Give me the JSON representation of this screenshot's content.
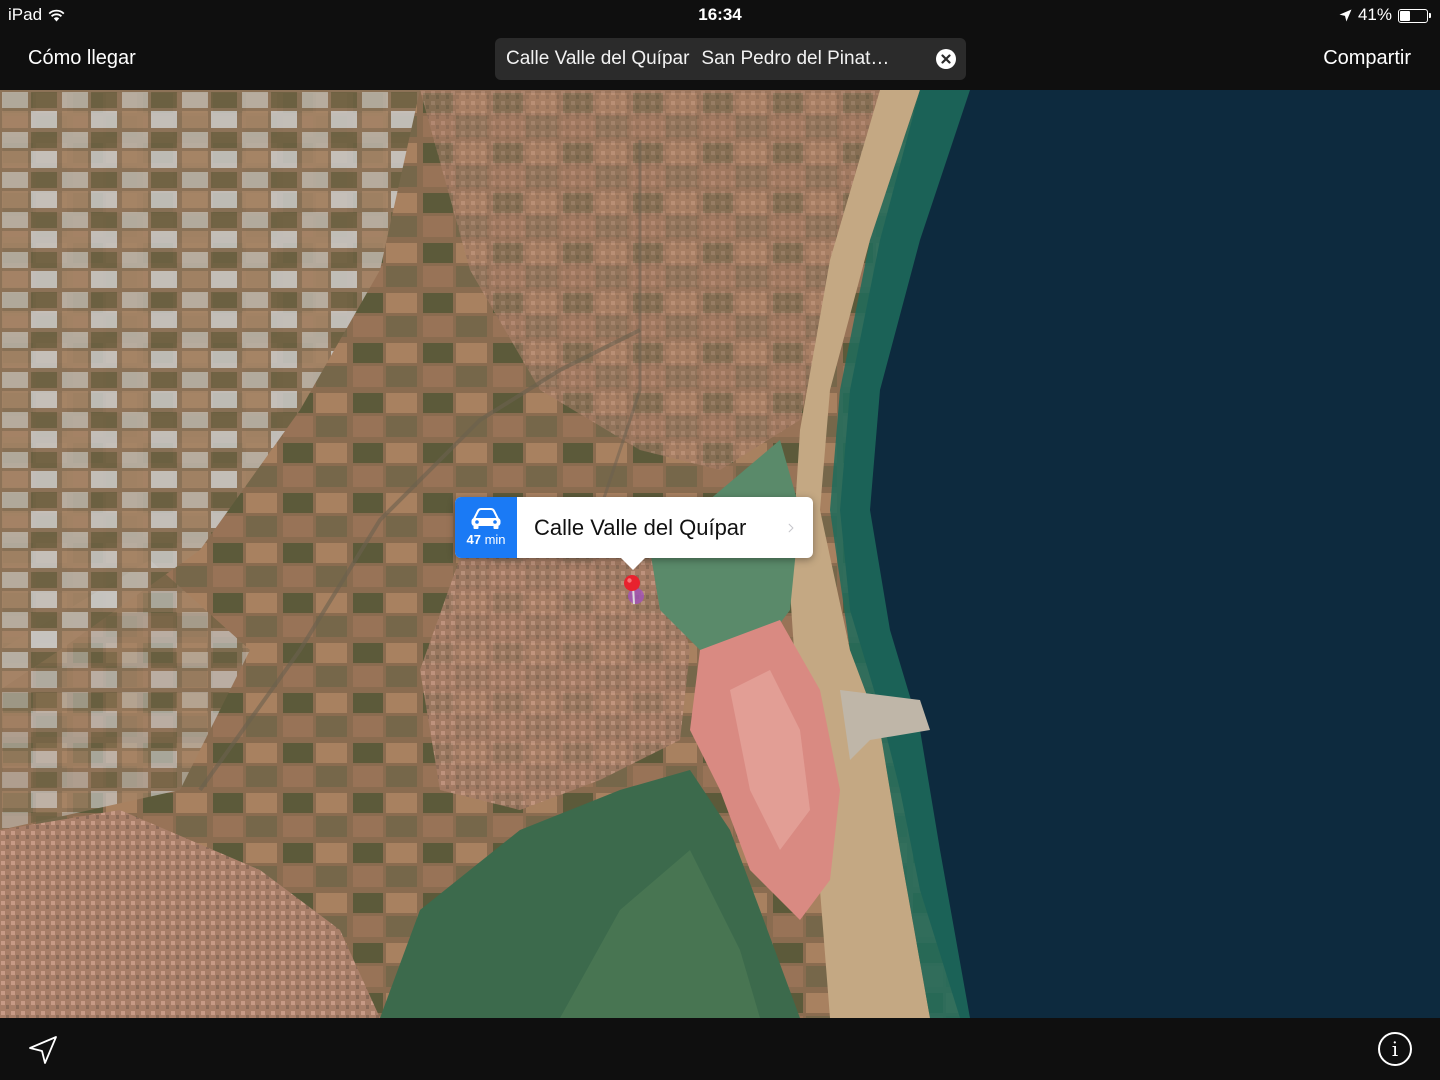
{
  "status_bar": {
    "device": "iPad",
    "time": "16:34",
    "battery_text": "41%",
    "battery_level": 0.41
  },
  "nav_bar": {
    "directions_label": "Cómo llegar",
    "search_primary": "Calle Valle del Quípar",
    "search_secondary": "San Pedro del Pinat…",
    "share_label": "Compartir"
  },
  "callout": {
    "title": "Calle Valle del Quípar",
    "drive_minutes": "47",
    "drive_unit": "min"
  },
  "icons": {
    "wifi": "wifi-icon",
    "location_arrow": "location-arrow-icon",
    "clear": "clear-icon",
    "car": "car-icon",
    "chevron": "chevron-right-icon",
    "pin": "map-pin-icon",
    "track_location": "location-button-icon",
    "info": "info-icon"
  },
  "colors": {
    "bar_background": "#0f0f0f",
    "accent_blue": "#1a7af5",
    "pin_red": "#e8222e",
    "sea": "#0d2a3e",
    "lagoon": "#3c6a4c",
    "salt_flats": "#d98a82"
  },
  "info_glyph": "i"
}
